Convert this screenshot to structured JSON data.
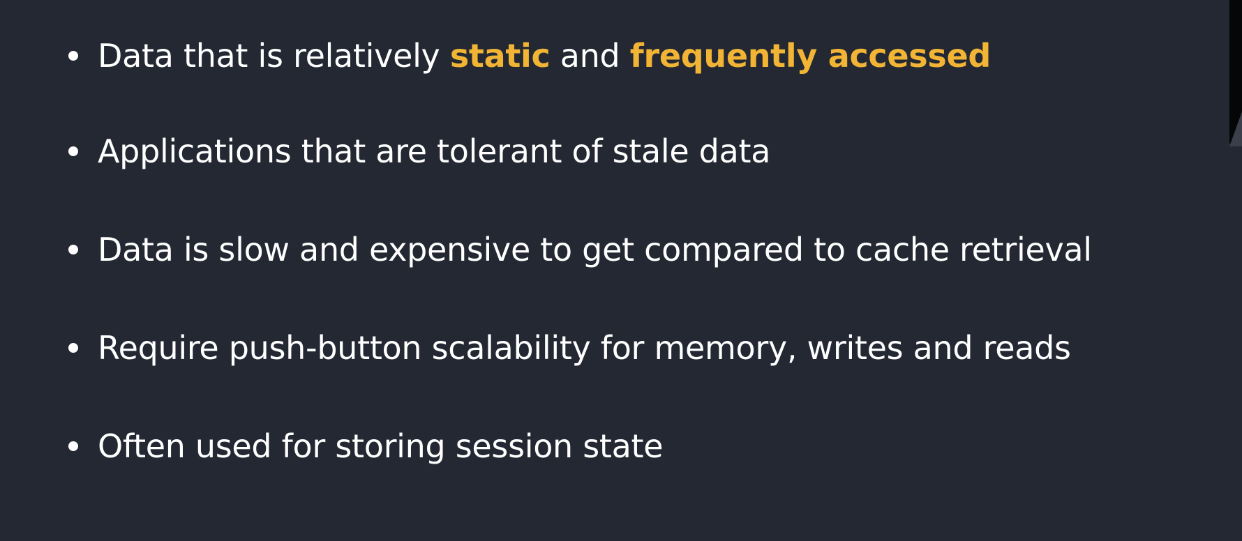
{
  "colors": {
    "background": "#232833",
    "text": "#ffffff",
    "highlight": "#f1b434"
  },
  "bullets": [
    {
      "parts": [
        {
          "text": "Data that is relatively ",
          "highlight": false
        },
        {
          "text": "static",
          "highlight": true
        },
        {
          "text": " and ",
          "highlight": false
        },
        {
          "text": "frequently accessed",
          "highlight": true
        }
      ]
    },
    {
      "parts": [
        {
          "text": "Applications that are tolerant of stale data",
          "highlight": false
        }
      ]
    },
    {
      "parts": [
        {
          "text": "Data is slow and expensive to get compared to cache retrieval",
          "highlight": false
        }
      ]
    },
    {
      "parts": [
        {
          "text": "Require push-button scalability for memory, writes and reads",
          "highlight": false
        }
      ]
    },
    {
      "parts": [
        {
          "text": "Often used for storing session state",
          "highlight": false
        }
      ]
    }
  ]
}
